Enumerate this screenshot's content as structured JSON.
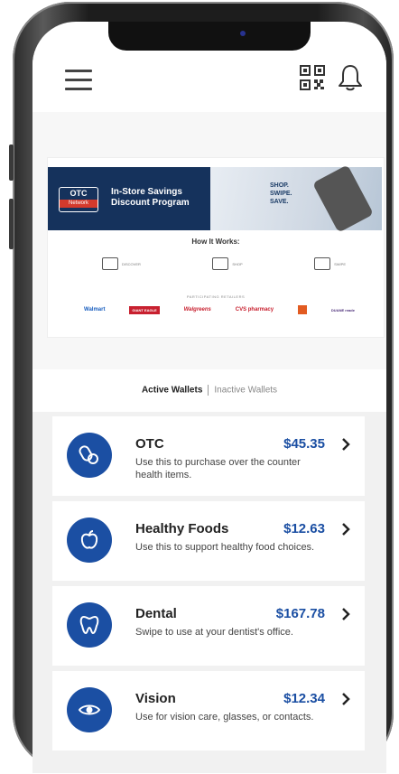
{
  "banner": {
    "badge_main": "OTC",
    "badge_sub": "Network",
    "title_line1": "In-Store Savings",
    "title_line2": "Discount Program",
    "shop_line1": "SHOP.",
    "shop_line2": "SWIPE.",
    "shop_line3": "SAVE.",
    "how_title": "How It Works:",
    "step1": "DISCOVER",
    "step2": "SHOP",
    "step3": "SWIPE",
    "retailers_title": "PARTICIPATING RETAILERS",
    "retailers": [
      "Walmart",
      "GIANT EAGLE",
      "Walgreens",
      "CVS pharmacy",
      "",
      "DUANE reade"
    ]
  },
  "tabs": {
    "active": "Active Wallets",
    "inactive": "Inactive Wallets"
  },
  "wallets": [
    {
      "name": "OTC",
      "amount": "$45.35",
      "description": "Use this to purchase over the counter health items.",
      "icon": "pills-icon"
    },
    {
      "name": "Healthy Foods",
      "amount": "$12.63",
      "description": "Use this to support healthy food choices.",
      "icon": "apple-icon"
    },
    {
      "name": "Dental",
      "amount": "$167.78",
      "description": "Swipe to use at your dentist's office.",
      "icon": "tooth-icon"
    },
    {
      "name": "Vision",
      "amount": "$12.34",
      "description": "Use for vision care, glasses, or contacts.",
      "icon": "eye-icon"
    }
  ],
  "colors": {
    "accent": "#1b4fa3",
    "banner_navy": "#15325c",
    "otc_red": "#d33a2c"
  }
}
